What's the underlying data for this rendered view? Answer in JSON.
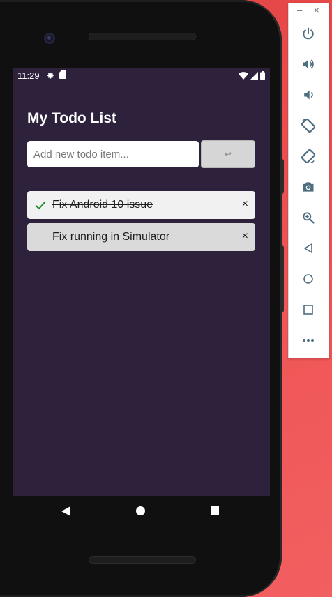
{
  "status": {
    "time": "11:29"
  },
  "app": {
    "title": "My Todo List",
    "input_placeholder": "Add new todo item...",
    "submit_label": "↩"
  },
  "todos": [
    {
      "text": "Fix Android 10 issue",
      "done": true,
      "remove": "×"
    },
    {
      "text": "Fix running in Simulator",
      "done": false,
      "remove": "×"
    }
  ],
  "emulator_panel": {
    "minimize": "–",
    "close": "×",
    "buttons": [
      "power-icon",
      "volume-up-icon",
      "volume-down-icon",
      "rotate-left-icon",
      "rotate-right-icon",
      "camera-icon",
      "zoom-icon",
      "back-icon",
      "home-icon",
      "overview-icon",
      "more-icon"
    ]
  },
  "colors": {
    "screen_bg": "#2d213b",
    "check": "#1f8a2e",
    "desktop_bg": "#e9494a"
  }
}
